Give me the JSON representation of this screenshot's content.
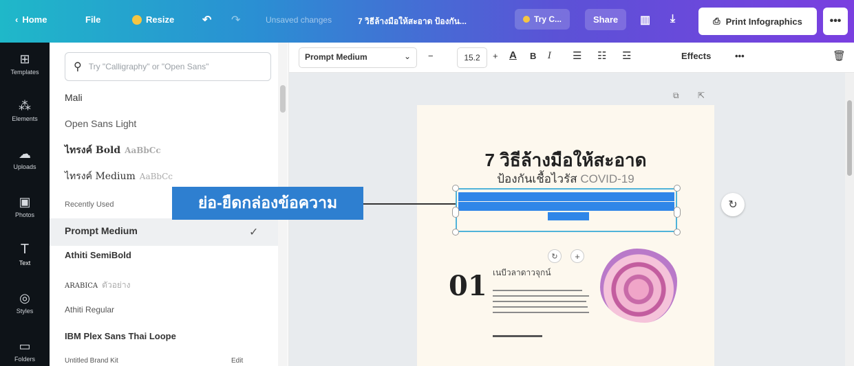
{
  "topbar": {
    "home_label": "Home",
    "file_label": "File",
    "resize_label": "Resize",
    "unsaved_label": "Unsaved changes",
    "doc_title": "7 วิธีล้างมือให้สะอาด ป้องกัน...",
    "try_label": "Try C...",
    "share_label": "Share",
    "print_label": "Print Infographics",
    "more_label": "•••"
  },
  "rail": {
    "items": [
      {
        "label": "Templates",
        "icon": "template-icon"
      },
      {
        "label": "Elements",
        "icon": "elements-icon"
      },
      {
        "label": "Uploads",
        "icon": "upload-icon"
      },
      {
        "label": "Photos",
        "icon": "photos-icon"
      },
      {
        "label": "Text",
        "icon": "text-icon"
      },
      {
        "label": "Styles",
        "icon": "styles-icon"
      },
      {
        "label": "Folders",
        "icon": "folder-icon"
      }
    ]
  },
  "panel": {
    "search_placeholder": "Try \"Calligraphy\" or \"Open Sans\"",
    "fonts_top": [
      {
        "name": "Mali",
        "sample": ""
      },
      {
        "name": "Open Sans Light",
        "sample": ""
      },
      {
        "name": "ไทรงค์ Bold",
        "sample": "AaBbCc"
      },
      {
        "name": "ไทรงค์ Medium",
        "sample": "AaBbCc"
      }
    ],
    "recently_used_label": "Recently Used",
    "recent_fonts": [
      {
        "name": "Prompt Medium",
        "sample": ""
      },
      {
        "name": "Athiti SemiBold",
        "sample": ""
      },
      {
        "name": "ARABICA",
        "sample": "ตัวอย่าง"
      },
      {
        "name": "Athiti Regular",
        "sample": ""
      },
      {
        "name": "IBM Plex Sans Thai Loope",
        "sample": ""
      }
    ],
    "check_mark": "✓",
    "brand_kit_label": "Untitled Brand Kit",
    "brand_edit_label": "Edit"
  },
  "toolbar": {
    "font_name": "Prompt Medium",
    "minus": "−",
    "font_size": "15.2",
    "plus": "+",
    "color_letter": "A",
    "bold": "B",
    "italic": "I",
    "effects_label": "Effects",
    "more": "•••"
  },
  "page": {
    "title": "7 วิธีล้างมือให้สะอาด",
    "subtitle_th": "ป้องกันเชื้อไวรัส",
    "subtitle_en": "COVID-19",
    "step_number": "01",
    "step_title": "เนบีวลาดาวจุกน์"
  },
  "callout": {
    "text": "ย่อ-ยืดกล่องข้อความ"
  }
}
